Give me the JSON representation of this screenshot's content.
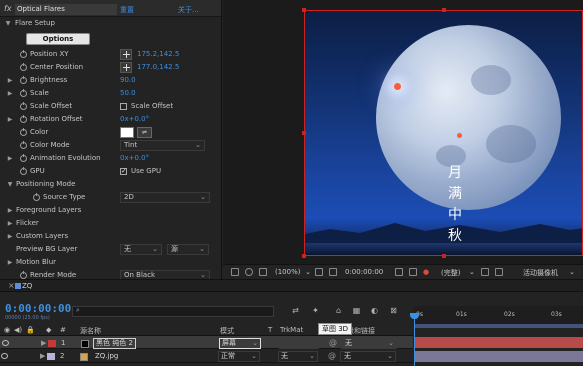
{
  "effect_controls": {
    "fx_prefix": "fx",
    "effect_name": "Optical Flares",
    "reset_label": "重置",
    "about_label": "关于...",
    "section_flare_setup": "Flare Setup",
    "options_button": "Options",
    "properties": [
      {
        "label": "Position XY",
        "value": "175.2,142.5"
      },
      {
        "label": "Center Position",
        "value": "177.0,142.5"
      },
      {
        "label": "Brightness",
        "value": "90.0"
      },
      {
        "label": "Scale",
        "value": "50.0"
      },
      {
        "label": "Scale Offset",
        "checkbox_label": "Scale Offset"
      },
      {
        "label": "Rotation Offset",
        "value": "0x+0.0°"
      },
      {
        "label": "Color"
      },
      {
        "label": "Color Mode",
        "value": "Tint"
      },
      {
        "label": "Animation Evolution",
        "value": "0x+0.0°"
      },
      {
        "label": "GPU",
        "checkbox_label": "Use GPU"
      },
      {
        "label": "Positioning Mode"
      },
      {
        "label": "Source Type",
        "value": "2D"
      },
      {
        "label": "Foreground Layers"
      },
      {
        "label": "Flicker"
      },
      {
        "label": "Custom Layers"
      },
      {
        "label": "Preview BG Layer",
        "value_1": "无",
        "value_2": "源"
      },
      {
        "label": "Motion Blur"
      },
      {
        "label": "Render Mode",
        "value": "On Black"
      }
    ]
  },
  "viewer": {
    "poem_chars": [
      "月",
      "满",
      "中",
      "秋"
    ],
    "zoom": "(100%)",
    "timecode": "0:00:00:00",
    "resolution": "(完整)",
    "camera": "活动摄像机"
  },
  "timeline": {
    "comp_tab": "ZQ",
    "current_time": "0:00:00:00",
    "fps_info": "00000 (25.00 fps)",
    "search_placeholder": "",
    "columns": {
      "source_name": "源名称",
      "mode": "模式",
      "t": "T",
      "trkmat": "TrkMat",
      "parent": "父级和链接",
      "hash": "#"
    },
    "tooltip": "草图 3D",
    "ruler_ticks": [
      "0s",
      "01s",
      "02s",
      "03s"
    ],
    "layers": [
      {
        "number": "1",
        "name": "黑色 纯色 2",
        "mode": "屏幕",
        "trkmat": "",
        "parent": "无",
        "label_color": "#c43a3a",
        "bar_color": "#b84a4a",
        "selected": true
      },
      {
        "number": "2",
        "name": "ZQ.jpg",
        "mode": "正常",
        "trkmat": "无",
        "parent": "无",
        "label_color": "#b9b3d8",
        "bar_color": "#7b7897",
        "selected": false
      }
    ]
  },
  "colors": {
    "accent_blue": "#3d8fe0",
    "panel_bg": "#232323",
    "selection_border": "#cc2222"
  }
}
